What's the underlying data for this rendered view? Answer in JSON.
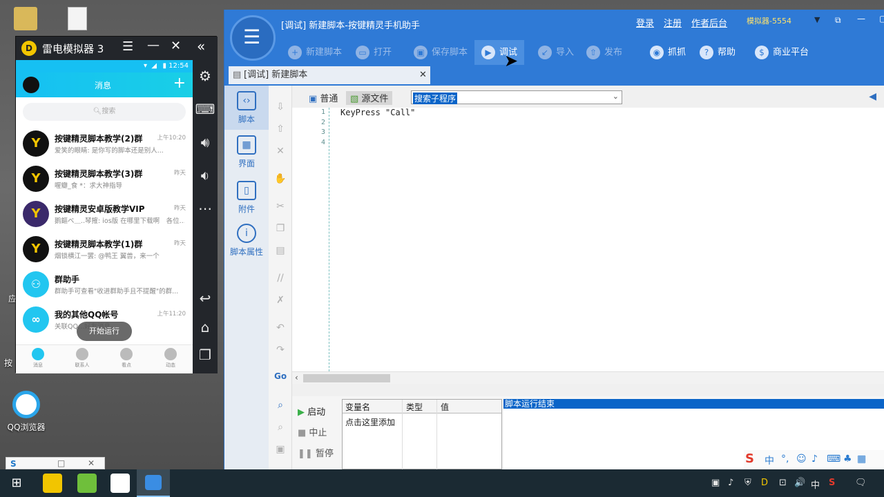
{
  "desktop": {
    "icons": [
      {
        "label": "应",
        "icon": "app-icon"
      },
      {
        "label": "按",
        "icon": "app-icon"
      },
      {
        "label": "QQ浏览器",
        "icon": "qq-browser-icon"
      }
    ],
    "mini_window": {
      "icon": "sogou-icon"
    }
  },
  "emulator": {
    "title": "雷电模拟器 3",
    "controls": [
      "menu-icon",
      "minimize-icon",
      "close-icon",
      "collapse-icon"
    ],
    "status_time": "12:54",
    "qq": {
      "header_title": "消息",
      "search_placeholder": "搜索",
      "chats": [
        {
          "name": "按键精灵脚本教学(2)群",
          "preview": "爱笑的眼睛: 是你写的脚本还是别人...",
          "time": "上午10:20"
        },
        {
          "name": "按键精灵脚本教学(3)群",
          "preview": "喔瓣_食 *：求大神指导",
          "time": "昨天"
        },
        {
          "name": "按键精灵安卓版教学VIP",
          "preview": "鹅鏂ベ＿..琴㩁: ios版 在哪里下载啊　各位...",
          "time": "昨天"
        },
        {
          "name": "按键精灵脚本教学(1)群",
          "preview": "烟锁横江一罢: @鸭王 翼兽，来一个",
          "time": "昨天"
        },
        {
          "name": "群助手",
          "preview": "群助手可查看\"收进群助手且不提醒\"的群...",
          "time": ""
        },
        {
          "name": "我的其他QQ帐号",
          "preview": "关联QQ...好友消息。",
          "time": "上午11:20"
        }
      ],
      "toast": "开始运行",
      "tabs": [
        "消息",
        "联系人",
        "看点",
        "动态"
      ]
    }
  },
  "app": {
    "title": "[调试] 新建脚本-按键精灵手机助手",
    "header_links": [
      "登录",
      "注册",
      "作者后台"
    ],
    "emulator_select": "模拟器-5554",
    "toolbar": [
      {
        "label": "新建脚本",
        "icon": "plus-icon",
        "enabled": false
      },
      {
        "label": "打开",
        "icon": "folder-icon",
        "enabled": false
      },
      {
        "label": "保存脚本",
        "icon": "save-icon",
        "enabled": false
      },
      {
        "label": "调试",
        "icon": "play-icon",
        "enabled": true
      },
      {
        "label": "导入",
        "icon": "import-icon",
        "enabled": false
      },
      {
        "label": "发布",
        "icon": "publish-icon",
        "enabled": false
      },
      {
        "label": "抓抓",
        "icon": "camera-icon",
        "enabled": true
      },
      {
        "label": "帮助",
        "icon": "help-icon",
        "enabled": true
      },
      {
        "label": "商业平台",
        "icon": "money-bag-icon",
        "enabled": true
      }
    ],
    "doc_tab": "[调试] 新建脚本",
    "nav": [
      {
        "label": "脚本",
        "icon": "script-icon"
      },
      {
        "label": "界面",
        "icon": "grid-icon"
      },
      {
        "label": "附件",
        "icon": "attachment-icon"
      },
      {
        "label": "脚本属性",
        "icon": "info-icon"
      }
    ],
    "view_modes": [
      "普通",
      "源文件"
    ],
    "subroutine_search": "搜索子程序",
    "code_lines": [
      "KeyPress \"Call\"",
      "",
      "",
      ""
    ],
    "line_numbers": [
      "1",
      "2",
      "3",
      "4"
    ],
    "run_controls": [
      "启动",
      "中止",
      "暂停"
    ],
    "var_headers": [
      "变量名",
      "类型",
      "值"
    ],
    "var_add": "点击这里添加",
    "log_text": "脚本运行结束",
    "colors": {
      "accent": "#2f7ad6",
      "log_highlight": "#0a64c8"
    }
  },
  "taskbar": {
    "tray": [
      "中",
      "🔊"
    ],
    "apps": [
      "windows-icon",
      "ldplayer-icon",
      "app2-icon",
      "app3-icon",
      "emulator-icon"
    ]
  }
}
